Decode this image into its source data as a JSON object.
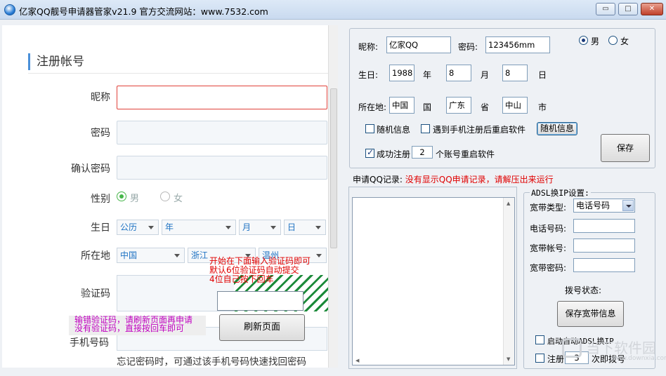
{
  "window": {
    "title": "亿家QQ靓号申请器管家v21.9 官方交流网站：www.7532.com",
    "min_label": "▭",
    "max_label": "□",
    "close_label": "✕"
  },
  "web": {
    "section_title": "注册帐号",
    "nickname_label": "昵称",
    "password_label": "密码",
    "confirm_label": "确认密码",
    "gender_label": "性别",
    "gender_male": "男",
    "gender_female": "女",
    "birthday_label": "生日",
    "calendar": "公历",
    "year": "年",
    "month": "月",
    "day": "日",
    "location_label": "所在地",
    "country": "中国",
    "province": "浙江",
    "city": "温州",
    "captcha_label": "验证码",
    "tip_line1": "开始在下面输入验证码即可",
    "tip_line2": "默认6位验证码自动提交",
    "tip_line3": "4位自己按下回车",
    "pink_line1": "输错验证码，请刷新页面再申请",
    "pink_line2": "没有验证码，直接按回车即可",
    "refresh_button": "刷新页面",
    "phone_label": "手机号码",
    "forgot_hint": "忘记密码时，可通过该手机号码快速找回密码"
  },
  "settings": {
    "nickname_label": "昵称:",
    "nickname_value": "亿家QQ",
    "password_label": "密码:",
    "password_value": "123456mm",
    "male": "男",
    "female": "女",
    "birthday_label": "生日:",
    "year_value": "1988",
    "year_unit": "年",
    "month_value": "8",
    "month_unit": "月",
    "day_value": "8",
    "day_unit": "日",
    "location_label": "所在地:",
    "country_value": "中国",
    "country_unit": "国",
    "province_value": "广东",
    "province_unit": "省",
    "city_value": "中山",
    "city_unit": "市",
    "random_info_check": "随机信息",
    "restart_on_phone_check": "遇到手机注册后重启软件",
    "random_info_button": "随机信息",
    "success_reg_prefix": "成功注册",
    "success_reg_count": "2",
    "success_reg_suffix": "个账号重启软件",
    "save_button": "保存"
  },
  "records": {
    "label": "申请QQ记录:",
    "message": "没有显示QQ申请记录，请解压出来运行"
  },
  "adsl": {
    "title": "ADSL换IP设置:",
    "type_label": "宽带类型:",
    "type_value": "电话号码",
    "phone_label": "电话号码:",
    "account_label": "宽带帐号:",
    "password_label": "宽带密码:",
    "status_label": "拨号状态:",
    "save_button": "保存宽带信息",
    "auto_check": "启动自动ADSL换IP",
    "register_prefix": "注册",
    "register_count": "3",
    "register_suffix": "次即拨号"
  },
  "watermark": {
    "text": "当下软件园",
    "url": "www.downxia.com"
  },
  "colors": {
    "accent": "#4a90d9",
    "error": "#e00000",
    "tip_pink": "#c000c0",
    "radio_on": "#47b64a"
  }
}
